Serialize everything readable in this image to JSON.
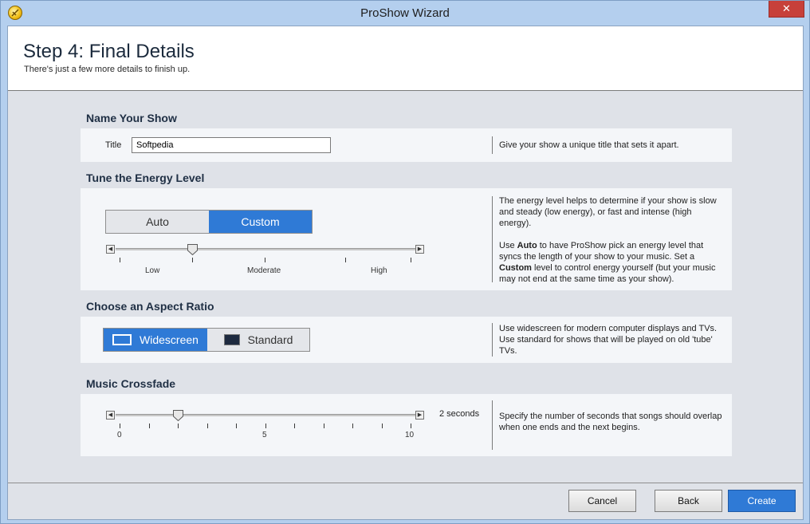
{
  "window": {
    "title": "ProShow Wizard",
    "close_glyph": "✕"
  },
  "header": {
    "title": "Step 4: Final Details",
    "subtitle": "There's just a few more details to finish up."
  },
  "name_section": {
    "heading": "Name Your Show",
    "title_label": "Title",
    "title_value": "Softpedia",
    "help": "Give your show a unique title that sets it apart."
  },
  "energy_section": {
    "heading": "Tune the Energy Level",
    "options": [
      "Auto",
      "Custom"
    ],
    "selected": "Custom",
    "slider_value_fraction": 0.25,
    "tick_labels": [
      "Low",
      "Moderate",
      "High"
    ],
    "help_p1": "The energy level helps to determine if your show is slow and steady (low energy), or fast and intense (high energy).",
    "help_p2_a": "Use ",
    "help_p2_auto": "Auto",
    "help_p2_b": " to have ProShow pick an energy level that syncs the length of your show to your music. Set a ",
    "help_p2_custom": "Custom",
    "help_p2_c": " level to control energy yourself (but your music may not end at the same time as your show)."
  },
  "aspect_section": {
    "heading": "Choose an Aspect Ratio",
    "options": [
      "Widescreen",
      "Standard"
    ],
    "selected": "Widescreen",
    "help": "Use widescreen for modern computer displays and TVs. Use standard for shows that will be played on old 'tube' TVs."
  },
  "crossfade_section": {
    "heading": "Music Crossfade",
    "value_text": "2 seconds",
    "value": 2,
    "min": 0,
    "max": 10,
    "tick_labels": [
      "0",
      "5",
      "10"
    ],
    "help": "Specify the number of seconds that songs should overlap when one ends and the next begins."
  },
  "footer": {
    "cancel": "Cancel",
    "back": "Back",
    "create": "Create"
  },
  "colors": {
    "accent": "#2f7ad6",
    "close": "#c7403a"
  }
}
